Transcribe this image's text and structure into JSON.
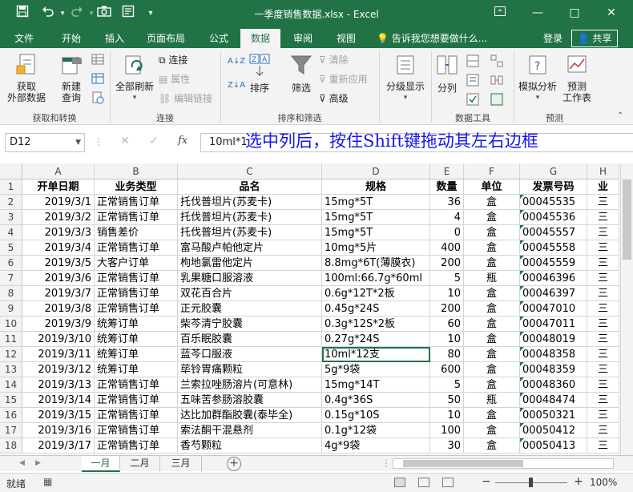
{
  "window": {
    "title": "一季度销售数据.xlsx - Excel",
    "controls": [
      "—",
      "□",
      "✕"
    ],
    "ribbon_display_icon": "ribbon-display-options-icon"
  },
  "quick_access": {
    "icons": [
      "save-icon",
      "undo-icon",
      "redo-icon",
      "camera-icon",
      "form-icon",
      "customize-icon"
    ]
  },
  "ribbon_tabs": [
    "文件",
    "开始",
    "插入",
    "页面布局",
    "公式",
    "数据",
    "审阅",
    "视图"
  ],
  "active_tab": "数据",
  "tell_me": "告诉我您想要做什么...",
  "login": "登录",
  "share": "共享",
  "ribbon": {
    "get_data": "获取\n外部数据",
    "new_query": "新建\n查询",
    "group_get_transform": "获取和转换",
    "refresh_all": "全部刷新",
    "connections": "连接",
    "properties": "属性",
    "edit_links": "编辑链接",
    "group_connections": "连接",
    "sort": "排序",
    "filter": "筛选",
    "clear": "清除",
    "reapply": "重新应用",
    "advanced": "高级",
    "group_sort_filter": "排序和筛选",
    "outline": "分级显示",
    "text_to_columns": "分列",
    "group_data_tools": "数据工具",
    "what_if": "模拟分析",
    "forecast_sheet": "预测\n工作表",
    "group_forecast": "预测"
  },
  "formula_bar": {
    "name_box": "D12",
    "cancel": "✕",
    "enter": "✓",
    "fx": "fx",
    "content": "10ml*1"
  },
  "overlay_text": "选中列后，按住Shift键拖动其左右边框",
  "columns": [
    "A",
    "B",
    "C",
    "D",
    "E",
    "F",
    "G",
    "H"
  ],
  "table": {
    "headers": [
      "开单日期",
      "业务类型",
      "品名",
      "规格",
      "数量",
      "单位",
      "发票号码",
      "业"
    ],
    "rows": [
      {
        "n": "2",
        "date": "2019/3/1",
        "type": "正常销售订单",
        "name": "托伐普坦片(苏麦卡)",
        "spec": "15mg*5T",
        "qty": "36",
        "unit": "盒",
        "inv": "00045535",
        "h": "三"
      },
      {
        "n": "3",
        "date": "2019/3/2",
        "type": "正常销售订单",
        "name": "托伐普坦片(苏麦卡)",
        "spec": "15mg*5T",
        "qty": "4",
        "unit": "盒",
        "inv": "00045536",
        "h": "三"
      },
      {
        "n": "4",
        "date": "2019/3/3",
        "type": "销售差价",
        "name": "托伐普坦片(苏麦卡)",
        "spec": "15mg*5T",
        "qty": "0",
        "unit": "盒",
        "inv": "00045557",
        "h": "三"
      },
      {
        "n": "5",
        "date": "2019/3/4",
        "type": "正常销售订单",
        "name": "富马酸卢帕他定片",
        "spec": "10mg*5片",
        "qty": "400",
        "unit": "盒",
        "inv": "00045558",
        "h": "三"
      },
      {
        "n": "6",
        "date": "2019/3/5",
        "type": "大客户订单",
        "name": "枸地氯雷他定片",
        "spec": "8.8mg*6T(薄膜衣)",
        "qty": "200",
        "unit": "盒",
        "inv": "00045559",
        "h": "三"
      },
      {
        "n": "7",
        "date": "2019/3/6",
        "type": "正常销售订单",
        "name": "乳果糖口服溶液",
        "spec": "100ml:66.7g*60ml",
        "qty": "5",
        "unit": "瓶",
        "inv": "00046396",
        "h": "三"
      },
      {
        "n": "8",
        "date": "2019/3/7",
        "type": "正常销售订单",
        "name": "双花百合片",
        "spec": "0.6g*12T*2板",
        "qty": "10",
        "unit": "盒",
        "inv": "00046397",
        "h": "三"
      },
      {
        "n": "9",
        "date": "2019/3/8",
        "type": "正常销售订单",
        "name": "正元胶囊",
        "spec": "0.45g*24S",
        "qty": "200",
        "unit": "盒",
        "inv": "00047010",
        "h": "三"
      },
      {
        "n": "10",
        "date": "2019/3/9",
        "type": "统筹订单",
        "name": "柴芩清宁胶囊",
        "spec": "0.3g*12S*2板",
        "qty": "60",
        "unit": "盒",
        "inv": "00047011",
        "h": "三"
      },
      {
        "n": "11",
        "date": "2019/3/10",
        "type": "统筹订单",
        "name": "百乐眠胶囊",
        "spec": "0.27g*24S",
        "qty": "10",
        "unit": "盒",
        "inv": "00048019",
        "h": "三"
      },
      {
        "n": "12",
        "date": "2019/3/11",
        "type": "统筹订单",
        "name": "蓝芩口服液",
        "spec": "10ml*12支",
        "qty": "80",
        "unit": "盒",
        "inv": "00048358",
        "h": "三"
      },
      {
        "n": "13",
        "date": "2019/3/12",
        "type": "统筹订单",
        "name": "荜铃胃痛颗粒",
        "spec": "5g*9袋",
        "qty": "600",
        "unit": "盒",
        "inv": "00048359",
        "h": "三"
      },
      {
        "n": "14",
        "date": "2019/3/13",
        "type": "正常销售订单",
        "name": "兰索拉唑肠溶片(可意林)",
        "spec": "15mg*14T",
        "qty": "5",
        "unit": "盒",
        "inv": "00048360",
        "h": "三"
      },
      {
        "n": "15",
        "date": "2019/3/14",
        "type": "正常销售订单",
        "name": "五味苦参肠溶胶囊",
        "spec": "0.4g*36S",
        "qty": "50",
        "unit": "瓶",
        "inv": "00048474",
        "h": "三"
      },
      {
        "n": "16",
        "date": "2019/3/15",
        "type": "正常销售订单",
        "name": "达比加群酯胶囊(泰毕全)",
        "spec": "0.15g*10S",
        "qty": "10",
        "unit": "盒",
        "inv": "00050321",
        "h": "三"
      },
      {
        "n": "17",
        "date": "2019/3/16",
        "type": "正常销售订单",
        "name": "索法酮干混悬剂",
        "spec": "0.1g*12袋",
        "qty": "100",
        "unit": "盒",
        "inv": "00050412",
        "h": "三"
      },
      {
        "n": "18",
        "date": "2019/3/17",
        "type": "正常销售订单",
        "name": "香芍颗粒",
        "spec": "4g*9袋",
        "qty": "30",
        "unit": "盒",
        "inv": "00050413",
        "h": "三"
      }
    ]
  },
  "sheets": [
    "一月",
    "二月",
    "三月"
  ],
  "active_sheet": "一月",
  "status": {
    "ready": "就绪",
    "zoom": "100%",
    "zoom_minus": "−",
    "zoom_plus": "+"
  },
  "colors": {
    "excel_green": "#217346",
    "overlay_blue": "#1515f0"
  }
}
